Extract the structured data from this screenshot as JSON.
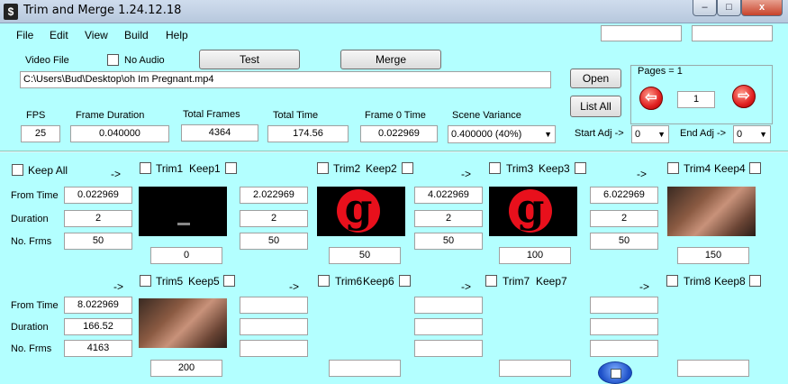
{
  "title": "Trim and Merge 1.24.12.18",
  "window_buttons": {
    "minimize": "–",
    "maximize": "□",
    "close": "x"
  },
  "menu": [
    "File",
    "Edit",
    "View",
    "Build",
    "Help"
  ],
  "top": {
    "video_file_label": "Video File",
    "no_audio_label": "No Audio",
    "test_label": "Test",
    "merge_label": "Merge",
    "file_path": "C:\\Users\\Bud\\Desktop\\oh Im Pregnant.mp4",
    "open_label": "Open",
    "list_all_label": "List All"
  },
  "pages": {
    "label": "Pages = 1",
    "value": "1",
    "prev": "⇦",
    "next": "⇨"
  },
  "stats": {
    "fps_label": "FPS",
    "fps": "25",
    "frame_duration_label": "Frame Duration",
    "frame_duration": "0.040000",
    "total_frames_label": "Total Frames",
    "total_frames": "4364",
    "total_time_label": "Total Time",
    "total_time": "174.56",
    "frame0_label": "Frame 0 Time",
    "frame0": "0.022969",
    "scene_variance_label": "Scene Variance",
    "scene_variance": "0.400000  (40%)",
    "start_adj_label": "Start Adj ->",
    "start_adj": "0",
    "end_adj_label": "End Adj ->",
    "end_adj": "0"
  },
  "grid": {
    "keep_all_label": "Keep All",
    "arrow": "->",
    "from_time_label": "From Time",
    "duration_label": "Duration",
    "frames_label": "No. Frms",
    "trims": [
      {
        "trim": "Trim1",
        "keep": "Keep1",
        "from": "0.022969",
        "duration": "2",
        "frames": "50",
        "frame_no": "0"
      },
      {
        "trim": "Trim2",
        "keep": "Keep2",
        "from": "2.022969",
        "duration": "2",
        "frames": "50",
        "frame_no": "50"
      },
      {
        "trim": "Trim3",
        "keep": "Keep3",
        "from": "4.022969",
        "duration": "2",
        "frames": "50",
        "frame_no": "100"
      },
      {
        "trim": "Trim4",
        "keep": "Keep4",
        "from": "6.022969",
        "duration": "2",
        "frames": "50",
        "frame_no": "150"
      },
      {
        "trim": "Trim5",
        "keep": "Keep5",
        "from": "8.022969",
        "duration": "166.52",
        "frames": "4163",
        "frame_no": "200"
      },
      {
        "trim": "Trim6",
        "keep": "Keep6",
        "from": "",
        "duration": "",
        "frames": "",
        "frame_no": ""
      },
      {
        "trim": "Trim7",
        "keep": "Keep7",
        "from": "",
        "duration": "",
        "frames": "",
        "frame_no": ""
      },
      {
        "trim": "Trim8",
        "keep": "Keep8",
        "from": "",
        "duration": "",
        "frames": "",
        "frame_no": ""
      }
    ],
    "logo_letter": "g"
  },
  "colors": {
    "background": "#b3ffff",
    "logo_red": "#e8101c"
  }
}
